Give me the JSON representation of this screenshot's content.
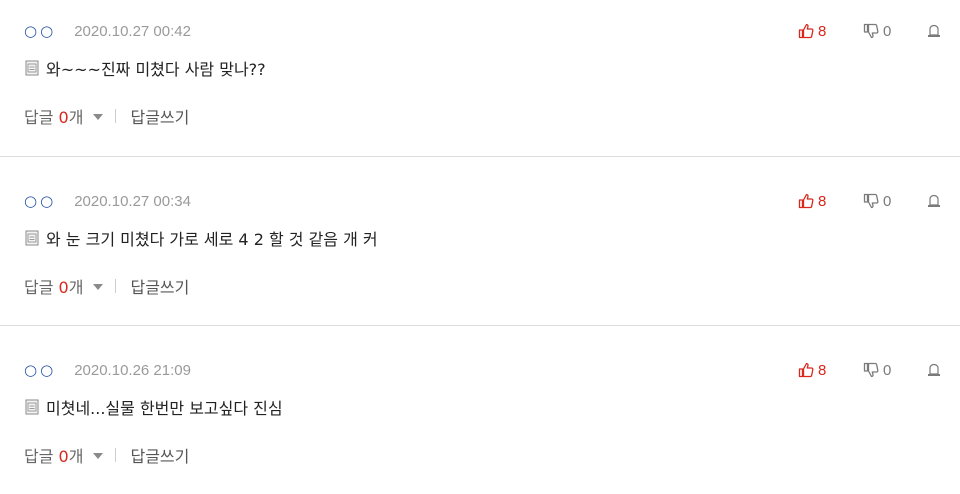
{
  "comments": [
    {
      "nickname": "○○",
      "date": "2020.10.27 00:42",
      "up": "8",
      "down": "0",
      "text": "와~~~진짜 미쳤다 사람 맞나??",
      "reply_label": "답글",
      "reply_count": "0",
      "reply_unit": "개",
      "write_reply": "답글쓰기"
    },
    {
      "nickname": "○○",
      "date": "2020.10.27 00:34",
      "up": "8",
      "down": "0",
      "text": "와 눈 크기 미쳤다 가로 세로 4 2 할 것 같음 개 커",
      "reply_label": "답글",
      "reply_count": "0",
      "reply_unit": "개",
      "write_reply": "답글쓰기"
    },
    {
      "nickname": "○○",
      "date": "2020.10.26 21:09",
      "up": "8",
      "down": "0",
      "text": "미쳣네...실물 한번만 보고싶다 진심",
      "reply_label": "답글",
      "reply_count": "0",
      "reply_unit": "개",
      "write_reply": "답글쓰기"
    }
  ],
  "icons": {
    "like": "thumbs-up-icon",
    "dislike": "thumbs-down-icon",
    "report": "report-icon",
    "memo": "memo-icon"
  },
  "colors": {
    "accent": "#d8271c",
    "nickname": "#2a57a8",
    "muted": "#9a9a9a"
  }
}
